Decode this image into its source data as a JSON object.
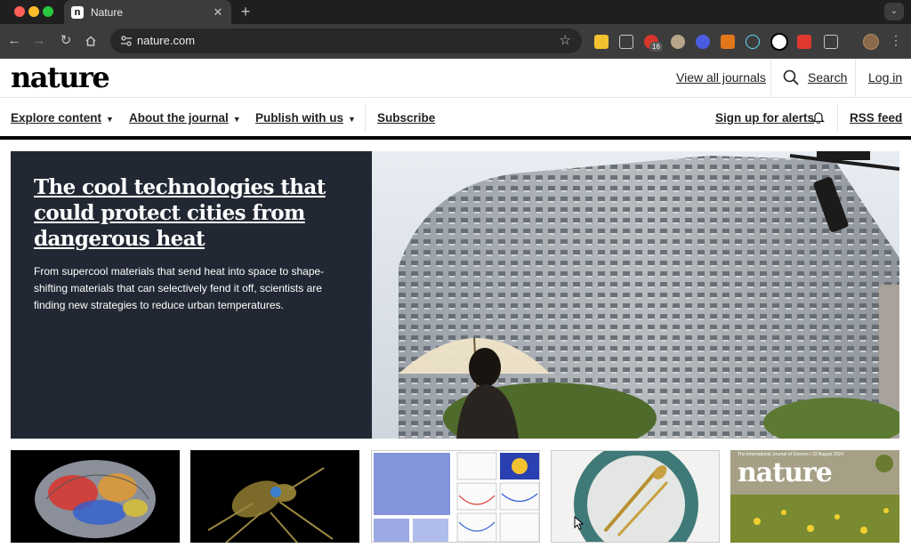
{
  "browser": {
    "tab_title": "Nature",
    "tab_favicon_letter": "n",
    "url": "nature.com",
    "ext_badge": "16"
  },
  "header": {
    "logo": "nature",
    "view_all_journals": "View all journals",
    "search": "Search",
    "login": "Log in"
  },
  "nav": {
    "explore": "Explore content",
    "about": "About the journal",
    "publish": "Publish with us",
    "subscribe": "Subscribe",
    "alerts": "Sign up for alerts",
    "rss": "RSS feed"
  },
  "hero": {
    "title": "The cool technologies that could protect cities from dangerous heat",
    "description": "From supercool materials that send heat into space to shape-shifting materials that can selectively fend it off, scientists are finding new strategies to reduce urban temperatures."
  },
  "cards": {
    "cover_title": "nature",
    "cover_small": "The International Journal of Science / 22 August 2024"
  },
  "colors": {
    "hero_bg": "#222833",
    "accent_black": "#000000",
    "chrome_dark": "#3c3c3c"
  }
}
